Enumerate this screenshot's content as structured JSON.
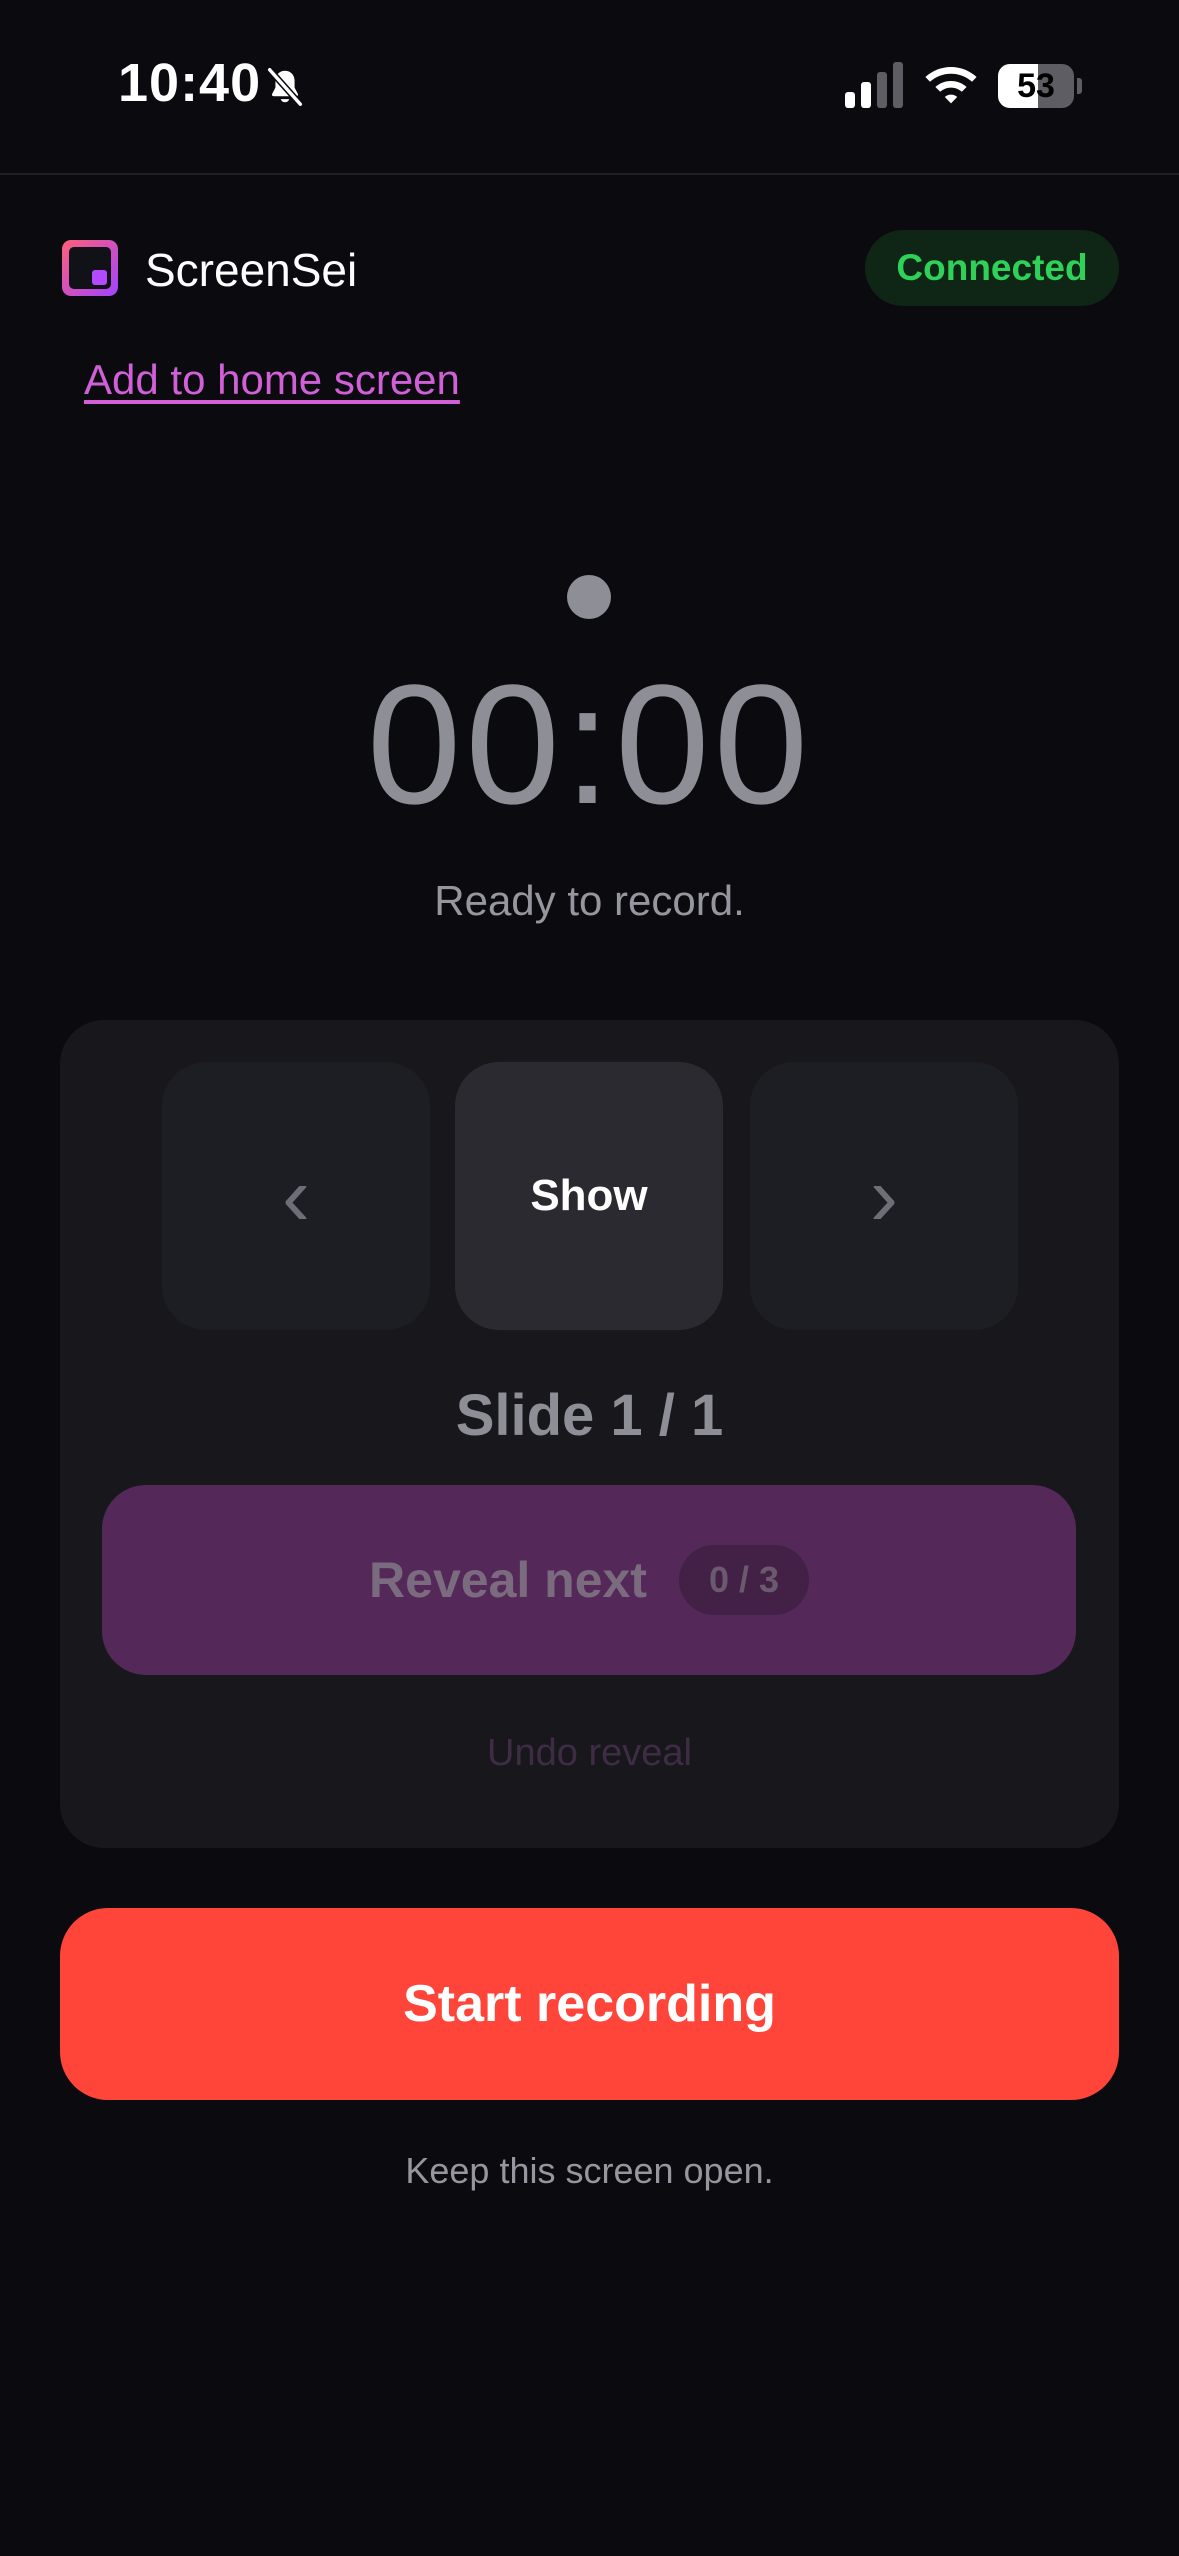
{
  "status_bar": {
    "time": "10:40",
    "battery": "53",
    "battery_level": 0.53,
    "icons": [
      "bell-slash-icon",
      "cellular-signal-icon",
      "wifi-icon",
      "battery-icon"
    ]
  },
  "header": {
    "title": "ScreenSei",
    "connection_status": "Connected",
    "add_home_link": "Add to home screen"
  },
  "recorder": {
    "timer": "00:00",
    "status": "Ready to record."
  },
  "slides": {
    "prev_label": "‹",
    "show_label": "Show",
    "next_label": "›",
    "counter": "Slide 1 / 1",
    "reveal_label": "Reveal next",
    "reveal_count": "0 / 3",
    "undo_label": "Undo reveal"
  },
  "actions": {
    "start_label": "Start recording",
    "hint": "Keep this screen open."
  },
  "colors": {
    "background": "#0a0a0f",
    "accent_record": "#ff453a",
    "connected_green": "#30d158",
    "link_magenta": "#d160d8",
    "reveal_purple": "#542959"
  }
}
